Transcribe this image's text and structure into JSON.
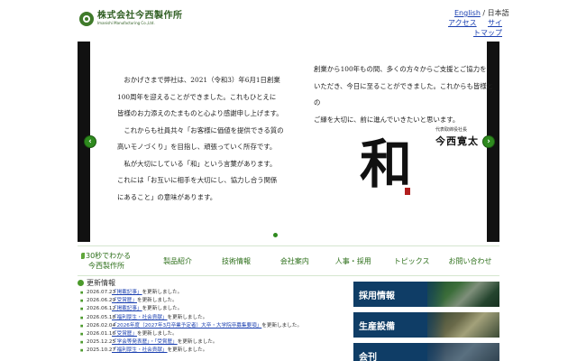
{
  "header": {
    "logo_jp": "株式会社今西製作所",
    "logo_en": "Imanishi Manufacturing Co.,Ltd.",
    "lang_english": "English",
    "lang_sep": " / ",
    "lang_japanese": "日本語",
    "util_access": "アクセス",
    "util_site_a": "サイ",
    "util_site_b": "トマップ"
  },
  "hero": {
    "arrow_prev": "‹",
    "arrow_next": "›",
    "left_lines": [
      "　おかげさまで弊社は、2021（令和3）年6月1日創業",
      "100周年を迎えることができました。これもひとえに",
      "皆様のお力添えのたまものと心より感謝申し上げます。",
      "　これからも社員共々「お客様に価値を提供できる質の",
      "高いモノづくり」を目指し、頑張っていく所存です。",
      "　私が大切にしている「和」という言葉があります。",
      "これには「お互いに相手を大切にし、協力し合う関係",
      "にあること」の意味があります。"
    ],
    "right_lines": [
      "創業から100年もの間、多くの方々からご支援とご協力を",
      "いただき、今日に至ることができました。これからも皆様との",
      "ご縁を大切に、前に進んでいきたいと思います。"
    ],
    "sign_title": "代表取締役社長",
    "sign_name": "今西寛太",
    "kanji": "和"
  },
  "nav": {
    "first_line1": "30秒でわかる",
    "first_line2": "今西製作所",
    "items": [
      "製品紹介",
      "技術情報",
      "会社案内",
      "人事・採用",
      "トピックス",
      "お問い合わせ"
    ]
  },
  "news": {
    "title": "更新情報",
    "items": [
      {
        "date": "2026.07.23",
        "link": "「掲載記事」",
        "rest": "を更新しました。"
      },
      {
        "date": "2026.06.29",
        "link": "「受賞歴」",
        "rest": "を更新しました。"
      },
      {
        "date": "2026.06.12",
        "link": "「掲載記事」",
        "rest": "を更新しました。"
      },
      {
        "date": "2026.05.18",
        "link": "「福利厚生・社会貢献」",
        "rest": "を更新しました。"
      },
      {
        "date": "2026.02.04",
        "link": "「2026年度（2027年3月卒業予定者）大卒・大学院卒募集要項」",
        "rest": "を更新しました。"
      },
      {
        "date": "2026.01.16",
        "link": "「受賞歴」",
        "rest": "を更新しました。"
      },
      {
        "date": "2025.12.25",
        "link": "「学会等発表歴」・「受賞歴」",
        "rest": "を更新しました。"
      },
      {
        "date": "2025.10.27",
        "link": "「福利厚生・社会貢献」",
        "rest": "を更新しました。"
      }
    ]
  },
  "banners": {
    "recruit": "採用情報",
    "equipment": "生産設備",
    "third": "会刊"
  }
}
